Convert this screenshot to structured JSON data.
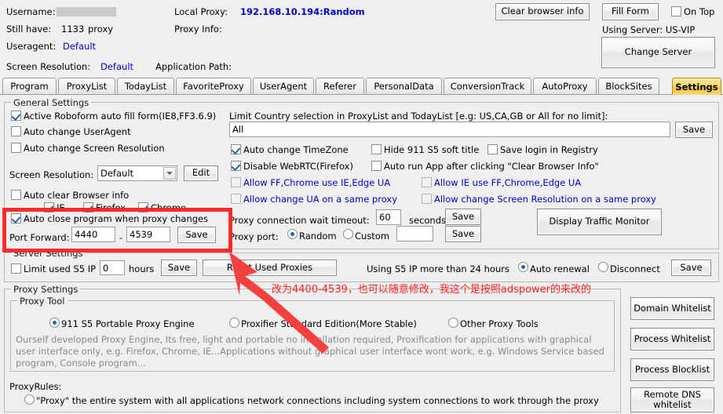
{
  "header": {
    "username_label": "Username:",
    "username_value": "",
    "still_have_label": "Still have:",
    "still_have_count": "1133",
    "still_have_unit": "proxy",
    "useragent_label": "Useragent:",
    "useragent_value": "Default",
    "screen_resolution_label": "Screen Resolution:",
    "screen_resolution_value": "Default",
    "local_proxy_label": "Local Proxy:",
    "local_proxy_value": "192.168.10.194:Random",
    "proxy_info_label": "Proxy Info:",
    "application_path_label": "Application Path:",
    "clear_browser_info_button": "Clear browser info",
    "fill_form_button": "Fill Form",
    "on_top_label": "On Top",
    "on_top_checked": false,
    "using_server_label": "Using Server: US-VIP",
    "change_server_button": "Change Server"
  },
  "tabs": [
    {
      "label": "Program",
      "active": false
    },
    {
      "label": "ProxyList",
      "active": false
    },
    {
      "label": "TodayList",
      "active": false
    },
    {
      "label": "FavoriteProxy",
      "active": false
    },
    {
      "label": "UserAgent",
      "active": false
    },
    {
      "label": "Referer",
      "active": false
    },
    {
      "label": "PersonalData",
      "active": false
    },
    {
      "label": "ConversionTrack",
      "active": false
    },
    {
      "label": "AutoProxy",
      "active": false
    },
    {
      "label": "BlockSites",
      "active": false
    },
    {
      "label": "Settings",
      "active": true
    }
  ],
  "general_settings": {
    "title": "General Settings",
    "active_roboform": {
      "label": "Active Roboform auto fill form(IE8,FF3.6.9)",
      "checked": true
    },
    "auto_change_useragent": {
      "label": "Auto change UserAgent",
      "checked": false
    },
    "auto_change_screen_resolution": {
      "label": "Auto change Screen Resolution",
      "checked": false
    },
    "screen_resolution_label": "Screen Resolution:",
    "screen_resolution_value": "Default",
    "edit_button": "Edit",
    "auto_clear_browser_info": {
      "label": "Auto clear Browser info",
      "checked": false
    },
    "browsers": [
      {
        "label": "IE",
        "checked": true
      },
      {
        "label": "Firefox",
        "checked": true
      },
      {
        "label": "Chrome",
        "checked": true
      }
    ],
    "auto_close_program": {
      "label": "Auto close program when proxy changes",
      "checked": true
    },
    "port_forward_label": "Port Forward:",
    "port_forward_from": "4440",
    "port_forward_dash": "-",
    "port_forward_to": "4539",
    "port_forward_save_button": "Save",
    "limit_country_label": "Limit Country selection in ProxyList and TodayList [e.g:  US,CA,GB  or All for no limit]:",
    "limit_country_value": "All",
    "limit_country_save_button": "Save",
    "auto_change_timezone": {
      "label": "Auto change TimeZone",
      "checked": true
    },
    "hide_911_title": {
      "label": "Hide 911 S5 soft title",
      "checked": false
    },
    "save_login_registry": {
      "label": "Save login in Registry",
      "checked": false
    },
    "disable_webrtc": {
      "label": "Disable WebRTC(Firefox)",
      "checked": true
    },
    "auto_run_app": {
      "label": "Auto run App after clicking \"Clear Browser Info\"",
      "checked": false
    },
    "allow_ff_chrome_ie_ua": {
      "label": "Allow FF,Chrome use IE,Edge UA",
      "checked": false
    },
    "allow_ie_ff_chrome_ua": {
      "label": "Allow IE use FF,Chrome,Edge UA",
      "checked": false
    },
    "allow_change_ua_same_proxy": {
      "label": "Allow change UA on a same proxy",
      "checked": false
    },
    "allow_change_res_same_proxy": {
      "label": "Allow change Screen Resolution on a same proxy",
      "checked": false
    },
    "proxy_timeout_label": "Proxy connection wait timeout:",
    "proxy_timeout_value": "60",
    "proxy_timeout_unit": "seconds",
    "proxy_timeout_save_button": "Save",
    "proxy_port_label": "Proxy port:",
    "proxy_port_random": {
      "label": "Random",
      "checked": true
    },
    "proxy_port_custom": {
      "label": "Custom",
      "checked": false
    },
    "proxy_port_custom_value": "",
    "proxy_port_save_button": "Save",
    "display_traffic_monitor_button": "Display Traffic Monitor"
  },
  "server_settings": {
    "title": "Server Settings",
    "limit_used_s5_ip": {
      "label": "Limit used S5 IP",
      "checked": false
    },
    "hours_value": "0",
    "hours_unit": "hours",
    "save_button": "Save",
    "reset_used_proxies_button": "Reset Used Proxies",
    "using_s5_label": "Using S5 IP more than 24 hours",
    "auto_renewal": {
      "label": "Auto renewal",
      "checked": true
    },
    "disconnect": {
      "label": "Disconnect",
      "checked": false
    },
    "save_button2": "Save"
  },
  "proxy_settings": {
    "title": "Proxy Settings",
    "proxy_tool_title": "Proxy Tool",
    "options": [
      {
        "label": "911 S5 Portable Proxy Engine",
        "checked": true
      },
      {
        "label": "Proxifier Standard Edition(More Stable)",
        "checked": false
      },
      {
        "label": "Other Proxy Tools",
        "checked": false
      }
    ],
    "description": "Ourself developed Proxy Engine, Its free, light and portable no installation required, Proxification for applications with graphical user interface only, e.g. Firefox, Chrome, IE...Applications without graphical user interface wont work, e.g. Windows Service based program, Console program...",
    "proxy_rules_label": "ProxyRules:",
    "rule_1": {
      "label": "\"Proxy\" the entire system with all applications network connections including system connections to work through the proxy",
      "checked": false
    }
  },
  "side_buttons": [
    {
      "label": "Domain Whitelist"
    },
    {
      "label": "Process Whitelist"
    },
    {
      "label": "Process Blocklist"
    },
    {
      "label": "Remote DNS\nwhitelist"
    }
  ],
  "annotation": {
    "text": "改为4400-4539，也可以随意修改，我这个是按照adspower的来改的",
    "color": "#ff2323"
  }
}
